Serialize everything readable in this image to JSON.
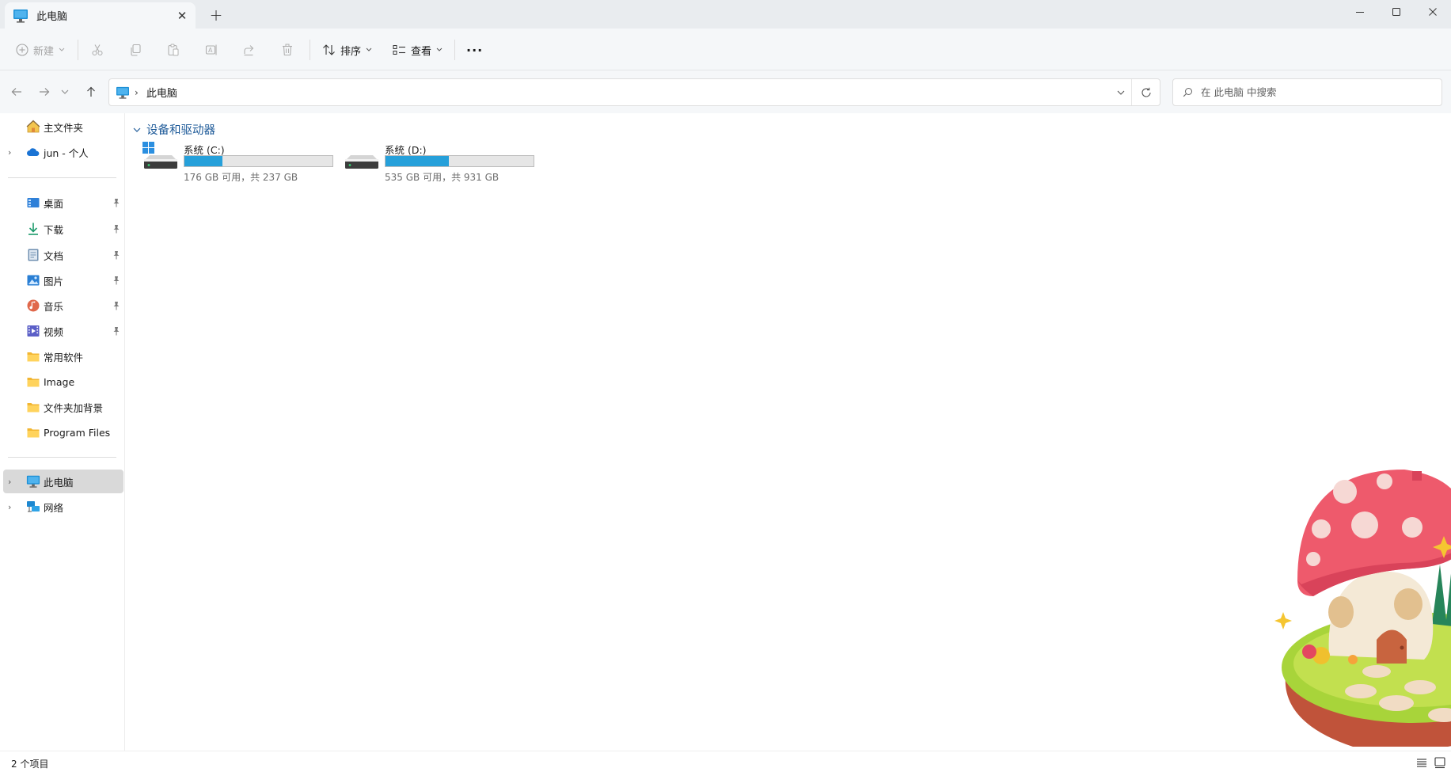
{
  "tab": {
    "title": "此电脑",
    "close": "✕",
    "new_tab": "+"
  },
  "toolbar": {
    "new_label": "新建",
    "sort_label": "排序",
    "view_label": "查看",
    "more_label": "···"
  },
  "address": {
    "crumb": "此电脑"
  },
  "search": {
    "placeholder": "在 此电脑 中搜索"
  },
  "sidebar": {
    "home": "主文件夹",
    "cloud": "jun - 个人",
    "quick": [
      {
        "label": "桌面",
        "icon": "desktop-icon",
        "pinned": true
      },
      {
        "label": "下载",
        "icon": "download-icon",
        "pinned": true
      },
      {
        "label": "文档",
        "icon": "documents-icon",
        "pinned": true
      },
      {
        "label": "图片",
        "icon": "pictures-icon",
        "pinned": true
      },
      {
        "label": "音乐",
        "icon": "music-icon",
        "pinned": true
      },
      {
        "label": "视频",
        "icon": "videos-icon",
        "pinned": true
      },
      {
        "label": "常用软件",
        "icon": "folder-icon",
        "pinned": false
      },
      {
        "label": "Image",
        "icon": "folder-icon",
        "pinned": false
      },
      {
        "label": "文件夹加背景",
        "icon": "folder-icon",
        "pinned": false
      },
      {
        "label": "Program Files",
        "icon": "folder-icon",
        "pinned": false
      }
    ],
    "this_pc": "此电脑",
    "network": "网络"
  },
  "content": {
    "group_title": "设备和驱动器",
    "drives": [
      {
        "name": "系统 (C:)",
        "info": "176 GB 可用，共 237 GB",
        "used_fraction": 0.2574,
        "os_drive": true
      },
      {
        "name": "系统 (D:)",
        "info": "535 GB 可用，共 931 GB",
        "used_fraction": 0.4253,
        "os_drive": false
      }
    ]
  },
  "status": {
    "count": "2 个项目"
  },
  "colors": {
    "accent": "#26a0da",
    "group_title": "#1f5b99",
    "selected_bg": "#d9d9d9"
  }
}
